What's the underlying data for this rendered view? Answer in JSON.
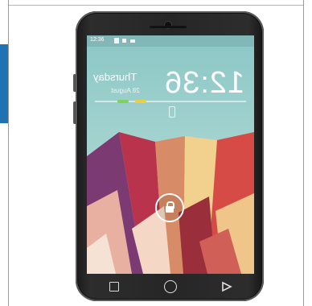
{
  "status_bar": {
    "time": "12:36"
  },
  "lockscreen": {
    "clock": "12:36",
    "day": "Thursday",
    "date": "28 August"
  },
  "colors": {
    "accent_blue": "#1f73b5",
    "phone_body": "#262626",
    "screen_sky": "#9dd0cd",
    "progress_green": "#7bd35a",
    "progress_yellow": "#f0cf3f",
    "lock_icon": "#ffffff"
  },
  "icons": {
    "lock": "lock-icon",
    "recent_apps": "square-icon",
    "home": "circle-icon",
    "back": "triangle-icon"
  }
}
